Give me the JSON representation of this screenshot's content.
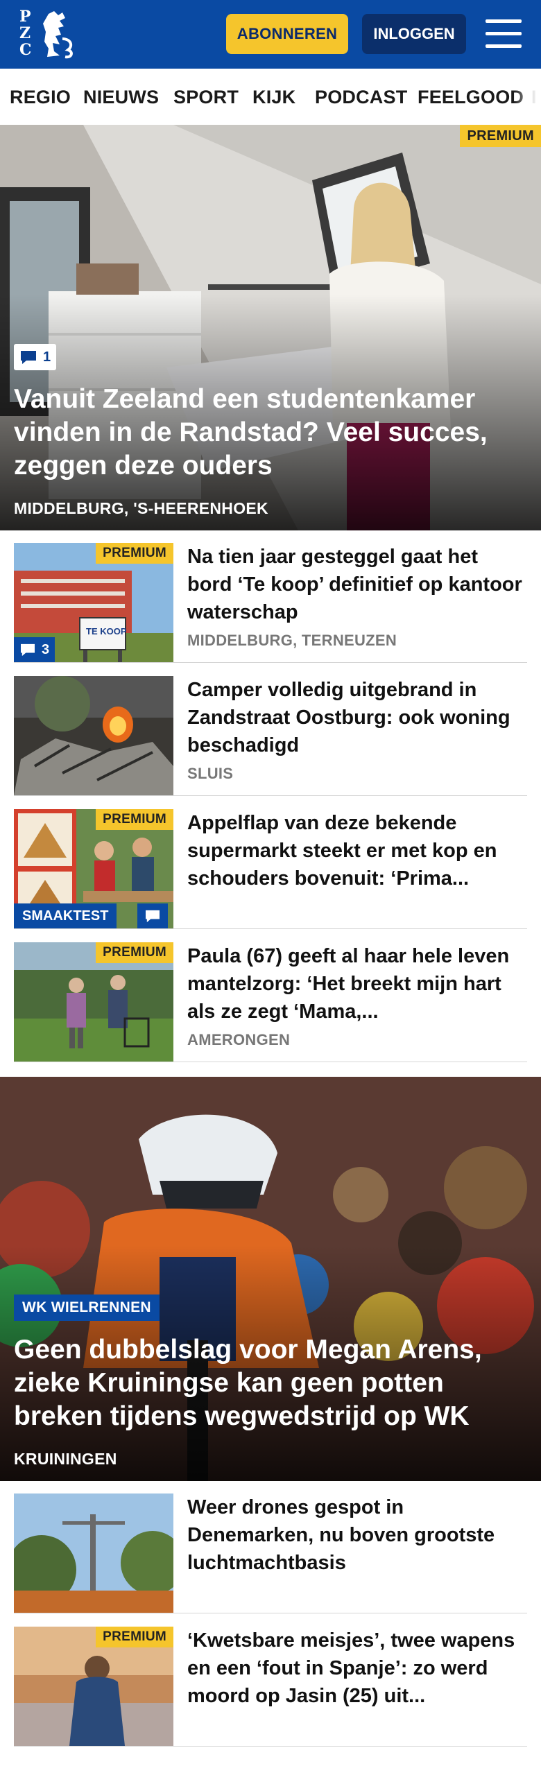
{
  "header": {
    "logo_letters": "PZC",
    "subscribe_label": "ABONNEREN",
    "login_label": "INLOGGEN",
    "menu_icon": "hamburger-menu-icon"
  },
  "nav": {
    "items": [
      "REGIO",
      "NIEUWS",
      "SPORT",
      "KIJK",
      "PODCAST",
      "FEELGOOD"
    ]
  },
  "hero1": {
    "badge": "PREMIUM",
    "comment_count": "1",
    "title": "Vanuit Zeeland een studentenkamer vinden in de Randstad? Veel succes, zeggen deze ouders",
    "location": "MIDDELBURG, 'S-HEERENHOEK"
  },
  "articles": [
    {
      "badge": "PREMIUM",
      "comment_count": "3",
      "sign_text": "TE KOOP",
      "title": "Na tien jaar gesteggel gaat het bord ‘Te koop’ definitief op kantoor waterschap",
      "location": "MIDDELBURG, TERNEUZEN"
    },
    {
      "title": "Camper volledig uitgebrand in Zandstraat Oostburg: ook woning beschadigd",
      "location": "SLUIS"
    },
    {
      "badge": "PREMIUM",
      "tag": "SMAAKTEST",
      "title": "Appelflap van deze bekende supermarkt steekt er met kop en schouders bovenuit: ‘Prima...",
      "location": ""
    },
    {
      "badge": "PREMIUM",
      "title": "Paula (67) geeft al haar hele leven mantelzorg: ‘Het breekt mijn hart als ze zegt ‘Mama,...",
      "location": "AMERONGEN"
    }
  ],
  "hero2": {
    "tag": "WK WIELRENNEN",
    "title": "Geen dubbelslag voor Megan Arens, zieke Kruiningse kan geen potten breken tijdens wegwedstrijd op WK",
    "location": "KRUININGEN"
  },
  "articles2": [
    {
      "title": "Weer drones gespot in Denemarken, nu boven grootste luchtmachtbasis",
      "location": ""
    },
    {
      "badge": "PREMIUM",
      "title": "‘Kwetsbare meisjes’, twee wapens en een ‘fout in Spanje’: zo werd moord op Jasin (25) uit...",
      "location": ""
    }
  ]
}
